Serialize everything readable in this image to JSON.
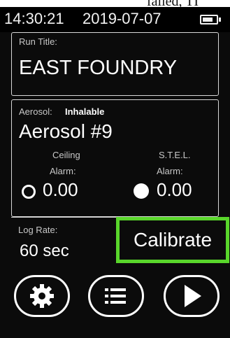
{
  "cropped_text": "failed, TI",
  "status": {
    "time": "14:30:21",
    "date": "2019-07-07",
    "battery_icon": "battery-icon"
  },
  "run": {
    "label": "Run Title:",
    "value": "EAST FOUNDRY"
  },
  "aerosol": {
    "label": "Aerosol:",
    "type": "Inhalable",
    "name": "Aerosol #9"
  },
  "ceiling": {
    "label": "Ceiling",
    "alarm_label": "Alarm:",
    "value": "0.00",
    "indicator": "ring-outline"
  },
  "stel": {
    "label": "S.T.E.L.",
    "alarm_label": "Alarm:",
    "value": "0.00",
    "indicator": "dot-filled"
  },
  "log_rate": {
    "label": "Log Rate:",
    "value": "60 sec"
  },
  "calibrate_label": "Calibrate",
  "buttons": {
    "settings_icon": "gear-icon",
    "menu_icon": "list-icon",
    "play_icon": "play-icon"
  },
  "colors": {
    "screen_bg": "#0b0b0b",
    "highlight": "#59d62b",
    "text": "#ffffff"
  }
}
